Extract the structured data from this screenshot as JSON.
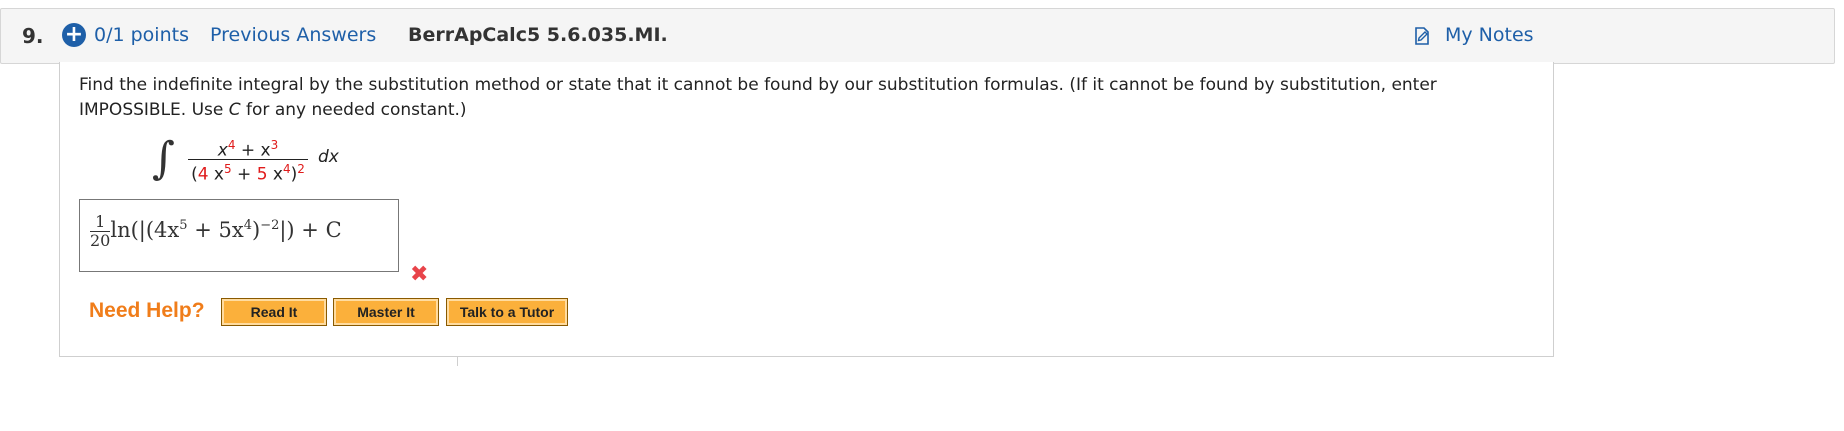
{
  "header": {
    "question_number": "9.",
    "plus_icon": "+",
    "points": "0/1 points",
    "previous_answers": "Previous Answers",
    "problem_code": "BerrApCalc5 5.6.035.MI.",
    "my_notes": "My Notes",
    "notes_icon": "notes-icon"
  },
  "question": {
    "prompt_part1": "Find the indefinite integral by the substitution method or state that it cannot be found by our substitution formulas. (If it cannot be found by substitution, enter IMPOSSIBLE. Use ",
    "prompt_c": "C",
    "prompt_part2": " for any needed constant.)",
    "integral_sign": "∫",
    "numerator": {
      "x": "x",
      "exp1": "4",
      "plus": " + x",
      "exp2": "3"
    },
    "denominator": {
      "open": "(",
      "coef1": "4",
      "x1": " x",
      "exp1": "5",
      "plus": " + ",
      "coef2": "5",
      "x2": " x",
      "exp2": "4",
      "close": ")",
      "exp3": "2"
    },
    "dx": "dx"
  },
  "answer": {
    "frac_num": "1",
    "frac_den": "20",
    "expression_a": "ln(|(4x",
    "exp_a": "5",
    "expression_b": " + 5x",
    "exp_b": "4",
    "expression_c": ")",
    "exp_c": "−2",
    "expression_d": "|) + C",
    "status": "incorrect"
  },
  "help": {
    "label": "Need Help?",
    "buttons": [
      "Read It",
      "Master It",
      "Talk to a Tutor"
    ]
  },
  "colors": {
    "link": "#1e5fa8",
    "error": "#e8444a",
    "help_label": "#f07d1a",
    "button_bg": "#fbb03b",
    "highlight_red": "#e01b1b"
  }
}
